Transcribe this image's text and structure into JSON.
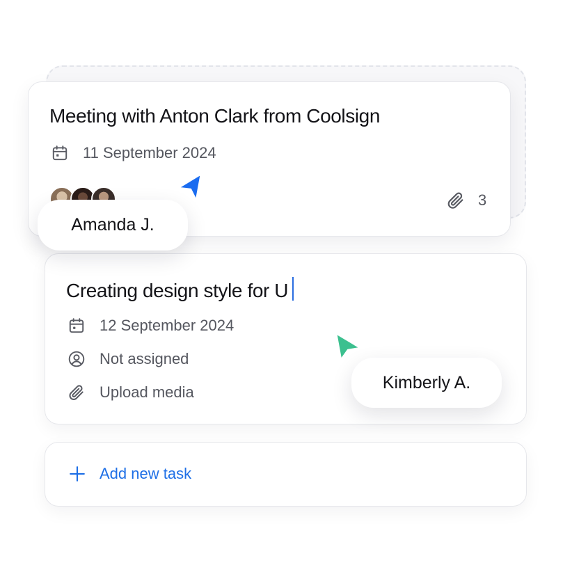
{
  "tasks": [
    {
      "title": "Meeting with Anton Clark from Coolsign",
      "date": "11 September 2024",
      "attachments_count": "3",
      "calendar_icon": "calendar-icon",
      "attachment_icon": "paperclip-icon"
    },
    {
      "title": "Creating design style for U",
      "date": "12 September 2024",
      "assignee": "Not assigned",
      "upload": "Upload media",
      "calendar_icon": "calendar-icon",
      "assignee_icon": "user-circle-icon",
      "upload_icon": "paperclip-icon"
    }
  ],
  "add_task": {
    "label": "Add new task",
    "icon": "plus-icon"
  },
  "collaborators": [
    {
      "name": "Amanda J.",
      "cursor_color": "#1a6cf0"
    },
    {
      "name": "Kimberly A.",
      "cursor_color": "#3cc08f"
    }
  ],
  "colors": {
    "accent": "#1e6fe6",
    "text_primary": "#141418",
    "text_secondary": "#55575f",
    "card_border": "#e6e7eb"
  }
}
